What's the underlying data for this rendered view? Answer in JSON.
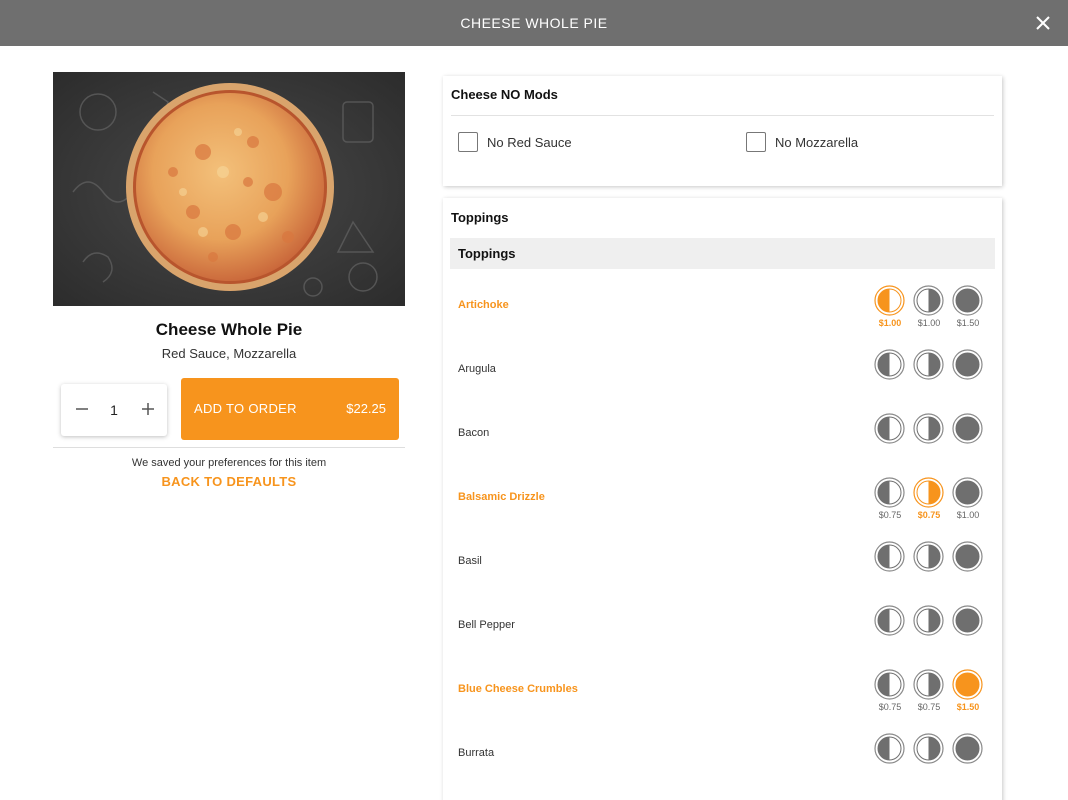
{
  "header": {
    "title": "CHEESE WHOLE PIE"
  },
  "item": {
    "name": "Cheese Whole Pie",
    "description": "Red Sauce, Mozzarella",
    "quantity": "1",
    "add_label": "ADD TO ORDER",
    "price": "$22.25",
    "saved_note": "We saved your preferences for this item",
    "back_label": "BACK TO DEFAULTS"
  },
  "mods": {
    "title": "Cheese NO Mods",
    "options": [
      {
        "label": "No Red Sauce"
      },
      {
        "label": "No Mozzarella"
      }
    ]
  },
  "toppings": {
    "title": "Toppings",
    "subheader": "Toppings",
    "items": [
      {
        "name": "Artichoke",
        "selected": "left",
        "prices": [
          "$1.00",
          "$1.00",
          "$1.50"
        ]
      },
      {
        "name": "Arugula",
        "selected": null,
        "prices": []
      },
      {
        "name": "Bacon",
        "selected": null,
        "prices": []
      },
      {
        "name": "Balsamic Drizzle",
        "selected": "right",
        "prices": [
          "$0.75",
          "$0.75",
          "$1.00"
        ]
      },
      {
        "name": "Basil",
        "selected": null,
        "prices": []
      },
      {
        "name": "Bell Pepper",
        "selected": null,
        "prices": []
      },
      {
        "name": "Blue Cheese Crumbles",
        "selected": "whole",
        "prices": [
          "$0.75",
          "$0.75",
          "$1.50"
        ]
      },
      {
        "name": "Burrata",
        "selected": null,
        "prices": []
      }
    ]
  },
  "colors": {
    "accent": "#f7941d",
    "topbar": "#6f6f6f",
    "portion": "#6f6f6f"
  }
}
